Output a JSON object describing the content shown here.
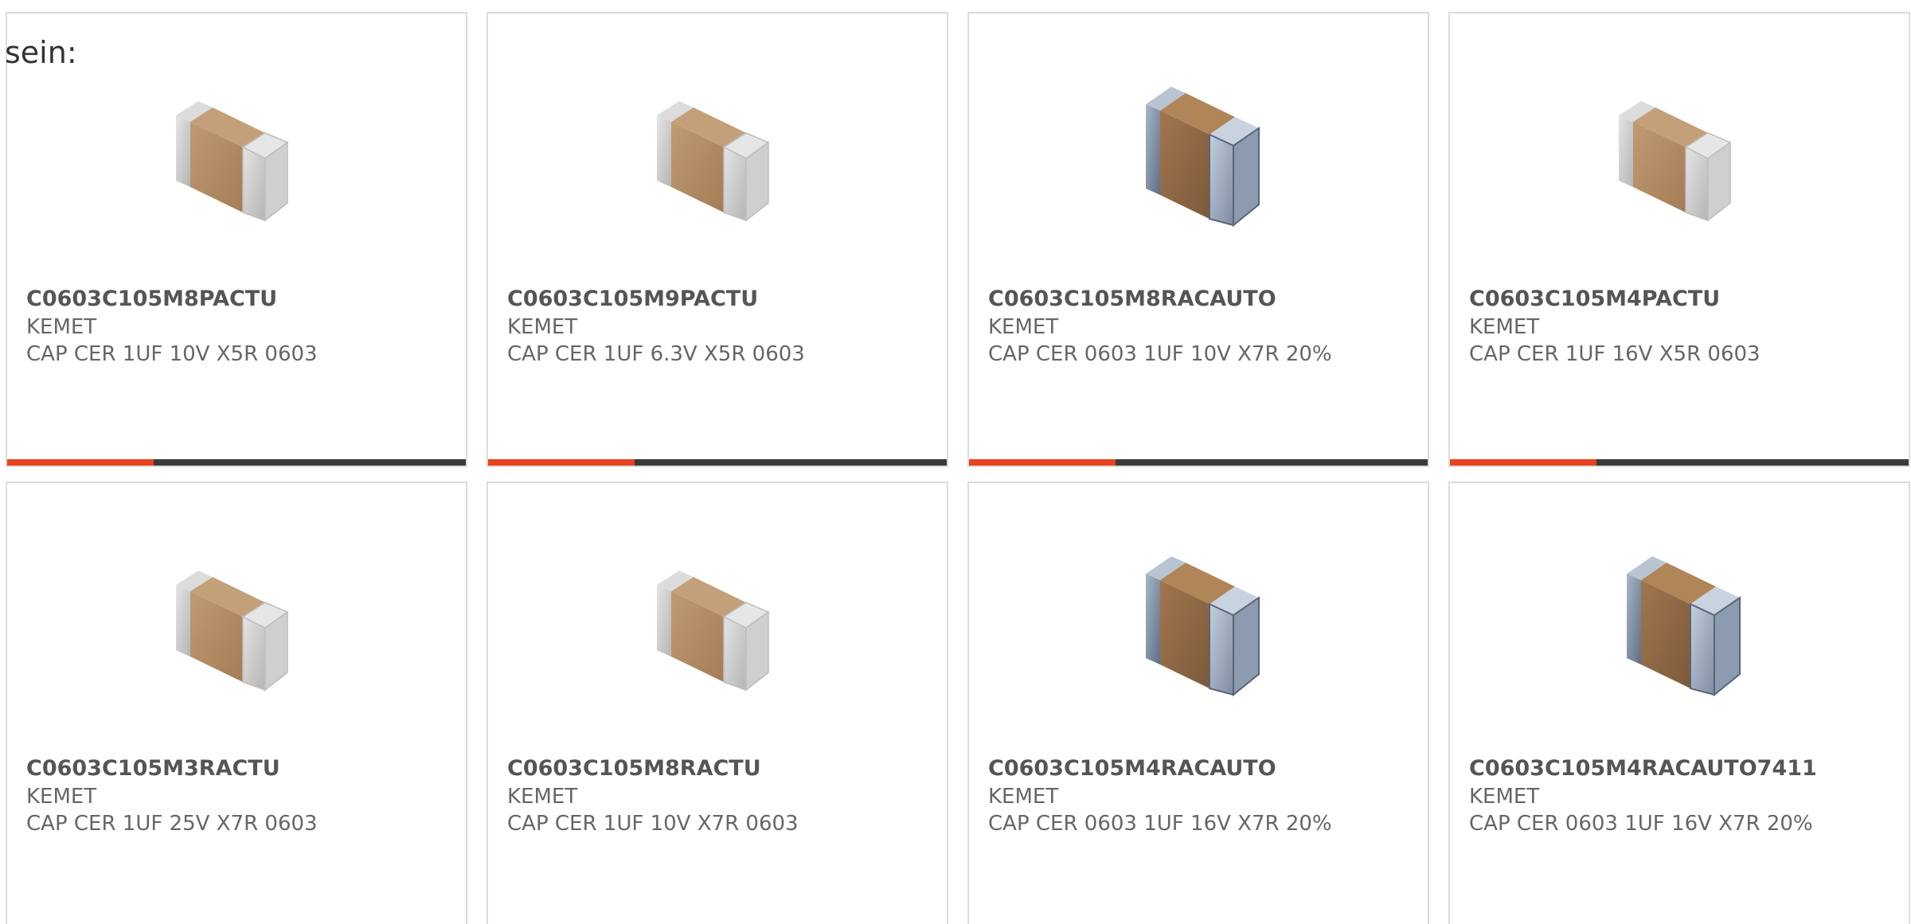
{
  "intro_text": "sein:",
  "colors": {
    "accent": "#e8431e",
    "track": "#3a3a3a",
    "card_border": "#dcdcdc",
    "text": "#666666"
  },
  "cards": [
    {
      "part_number": "C0603C105M8PACTU",
      "manufacturer": "KEMET",
      "description": "CAP CER 1UF 10V X5R 0603",
      "image": "capacitor-chip-grey-icon",
      "progress": 0.32
    },
    {
      "part_number": "C0603C105M9PACTU",
      "manufacturer": "KEMET",
      "description": "CAP CER 1UF 6.3V X5R 0603",
      "image": "capacitor-chip-grey-icon",
      "progress": 0.32
    },
    {
      "part_number": "C0603C105M8RACAUTO",
      "manufacturer": "KEMET",
      "description": "CAP CER 0603 1UF 10V X7R 20%",
      "image": "capacitor-chip-blue-icon",
      "progress": 0.32
    },
    {
      "part_number": "C0603C105M4PACTU",
      "manufacturer": "KEMET",
      "description": "CAP CER 1UF 16V X5R 0603",
      "image": "capacitor-chip-grey-icon",
      "progress": 0.32
    },
    {
      "part_number": "C0603C105M3RACTU",
      "manufacturer": "KEMET",
      "description": "CAP CER 1UF 25V X7R 0603",
      "image": "capacitor-chip-grey-icon"
    },
    {
      "part_number": "C0603C105M8RACTU",
      "manufacturer": "KEMET",
      "description": "CAP CER 1UF 10V X7R 0603",
      "image": "capacitor-chip-grey-icon"
    },
    {
      "part_number": "C0603C105M4RACAUTO",
      "manufacturer": "KEMET",
      "description": "CAP CER 0603 1UF 16V X7R 20%",
      "image": "capacitor-chip-blue-icon"
    },
    {
      "part_number": "C0603C105M4RACAUTO7411",
      "manufacturer": "KEMET",
      "description": "CAP CER 0603 1UF 16V X7R 20%",
      "image": "capacitor-chip-blue-icon"
    }
  ]
}
